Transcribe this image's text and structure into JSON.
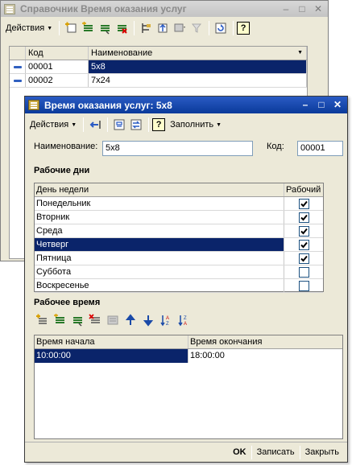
{
  "back_window": {
    "title": "Справочник Время оказания услуг",
    "menu_label": "Действия",
    "columns": [
      "Код",
      "Наименование"
    ],
    "rows": [
      {
        "code": "00001",
        "name": "5x8"
      },
      {
        "code": "00002",
        "name": "7x24"
      }
    ],
    "icons": [
      "add-icon",
      "add-group-icon",
      "copy-icon",
      "delete-icon",
      "hierarchy-icon",
      "folder-up-icon",
      "filter-icon",
      "filter-off-icon",
      "refresh-icon",
      "help-icon"
    ]
  },
  "front_window": {
    "title": "Время оказания услуг: 5x8",
    "menu_label": "Действия",
    "fill_label": "Заполнить",
    "help_label": "?",
    "name_label": "Наименование:",
    "name_value": "5x8",
    "code_label": "Код:",
    "code_value": "00001",
    "workdays_title": "Рабочие дни",
    "days_columns": [
      "День недели",
      "Рабочий"
    ],
    "days": [
      {
        "label": "Понедельник",
        "working": true
      },
      {
        "label": "Вторник",
        "working": true
      },
      {
        "label": "Среда",
        "working": true
      },
      {
        "label": "Четверг",
        "working": true
      },
      {
        "label": "Пятница",
        "working": true
      },
      {
        "label": "Суббота",
        "working": false
      },
      {
        "label": "Воскресенье",
        "working": false
      }
    ],
    "selected_day_index": 3,
    "worktime_title": "Рабочее время",
    "time_columns": [
      "Время начала",
      "Время окончания"
    ],
    "time_rows": [
      {
        "start": "10:00:00",
        "end": "18:00:00"
      }
    ],
    "buttons": {
      "ok": "OK",
      "save": "Записать",
      "close": "Закрыть"
    }
  },
  "colors": {
    "window_bg": "#ece9d8",
    "active_title": "#0a3a9a",
    "selection": "#0a246a"
  }
}
